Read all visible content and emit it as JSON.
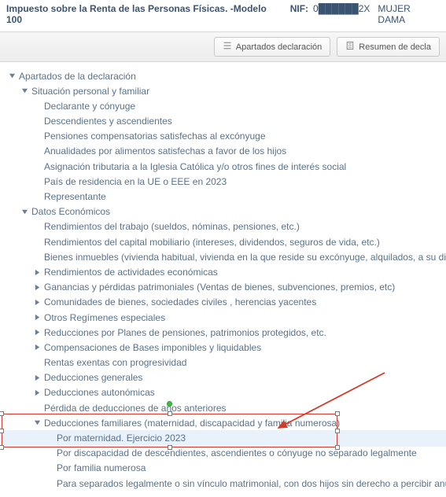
{
  "header": {
    "title": "Impuesto sobre la Renta de las Personas Físicas. -Modelo 100",
    "nif_label": "NIF:",
    "nif_value": "0██████2X",
    "nif_name": "MUJER DAMA"
  },
  "toolbar": {
    "btn_sections": "Apartados declaración",
    "btn_summary": "Resumen de decla"
  },
  "tree": {
    "root_label": "Apartados de la declaración",
    "situacion": {
      "label": "Situación personal y familiar",
      "children": [
        "Declarante y cónyuge",
        "Descendientes y ascendientes",
        "Pensiones compensatorias satisfechas al excónyuge",
        "Anualidades por alimentos satisfechas a favor de los hijos",
        "Asignación tributaria a la Iglesia Católica y/o otros fines de interés social",
        "País de residencia en la UE o EEE en 2023",
        "Representante"
      ]
    },
    "datos": {
      "label": "Datos Económicos",
      "leaf1": "Rendimientos del trabajo (sueldos, nóminas, pensiones, etc.)",
      "leaf2": "Rendimientos del capital mobiliario (intereses, dividendos, seguros de vida, etc.)",
      "leaf3": "Bienes inmuebles (vivienda habitual, vivienda en la que reside su excónyuge, alquilados, a su disposición o afectos a activi",
      "coll": [
        "Rendimientos de actividades económicas",
        "Ganancias y pérdidas patrimoniales (Ventas de bienes, subvenciones, premios, etc)",
        "Comunidades de bienes, sociedades civiles , herencias yacentes",
        "Otros Regímenes especiales",
        "Reducciones por Planes de pensiones, patrimonios protegidos, etc.",
        "Compensaciones de Bases imponibles y liquidables"
      ],
      "leaf4": "Rentas exentas con progresividad",
      "coll2": [
        "Deducciones generales",
        "Deducciones autonómicas"
      ],
      "leaf5": "Pérdida de deducciones de años anteriores",
      "familiares": {
        "label": "Deducciones familiares (maternidad, discapacidad y familia numerosa)",
        "children": [
          "Por maternidad. Ejercicio 2023",
          "Por discapacidad de descendientes, ascendientes o cónyuge no separado legalmente",
          "Por familia numerosa",
          "Para separados legalmente o sin vínculo matrimonial, con dos hijos sin derecho a percibir anualidades por alimentos"
        ]
      }
    }
  }
}
